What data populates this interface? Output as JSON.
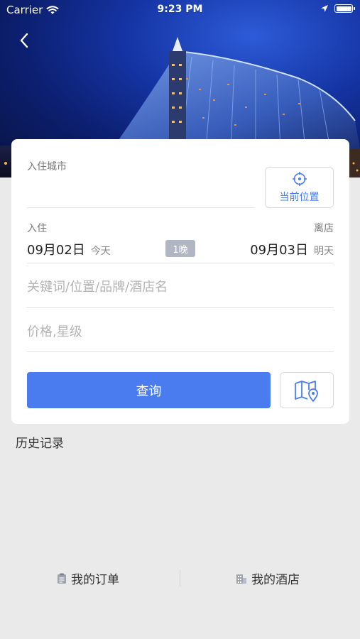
{
  "status_bar": {
    "carrier": "Carrier",
    "time": "9:23 PM"
  },
  "form": {
    "city_label": "入住城市",
    "current_location_label": "当前位置",
    "checkin_label": "入住",
    "checkout_label": "离店",
    "checkin_date": "09月02日",
    "checkin_day": "今天",
    "checkout_date": "09月03日",
    "checkout_day": "明天",
    "nights": "1晚",
    "keyword_placeholder": "关键词/位置/品牌/酒店名",
    "price_placeholder": "价格,星级",
    "query_label": "查询"
  },
  "history_label": "历史记录",
  "bottom_tabs": {
    "orders_label": "我的订单",
    "hotels_label": "我的酒店"
  },
  "colors": {
    "accent": "#4a7cf0",
    "background": "#eaeaea",
    "nights_badge": "#b1b6c3"
  },
  "icons": [
    "wifi-icon",
    "location-arrow-icon",
    "battery-icon",
    "back-chevron-icon",
    "crosshair-location-icon",
    "map-pin-icon",
    "clipboard-icon",
    "building-icon"
  ]
}
